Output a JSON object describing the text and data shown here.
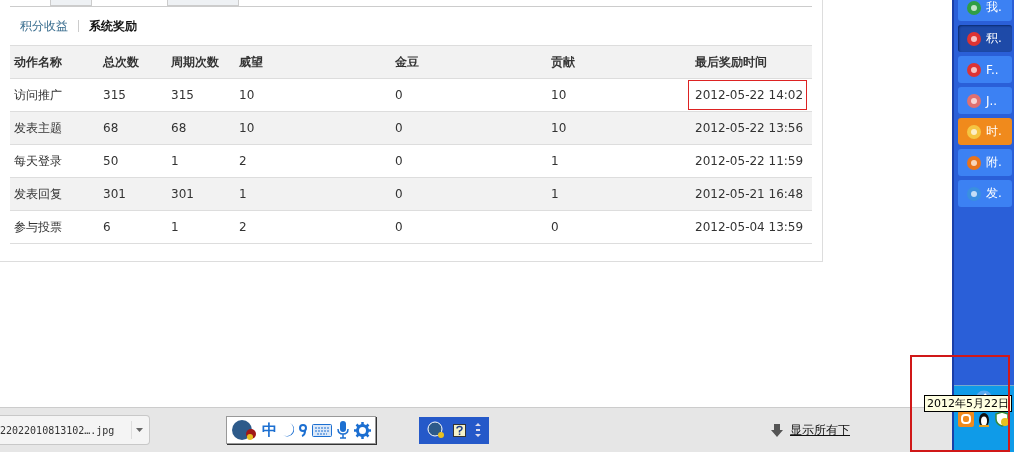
{
  "subtabs": [
    {
      "label": "积分收益",
      "selected": false
    },
    {
      "label": "系统奖励",
      "selected": true
    }
  ],
  "table": {
    "columns": [
      "动作名称",
      "总次数",
      "周期次数",
      "威望",
      "金豆",
      "贡献",
      "最后奖励时间"
    ],
    "rows": [
      {
        "cells": [
          "访问推广",
          "315",
          "315",
          "10",
          "0",
          "10",
          "2012-05-22 14:02"
        ],
        "highlighted": true
      },
      {
        "cells": [
          "发表主题",
          "68",
          "68",
          "10",
          "0",
          "10",
          "2012-05-22 13:56"
        ],
        "highlighted": false
      },
      {
        "cells": [
          "每天登录",
          "50",
          "1",
          "2",
          "0",
          "1",
          "2012-05-22 11:59"
        ],
        "highlighted": false
      },
      {
        "cells": [
          "发表回复",
          "301",
          "301",
          "1",
          "0",
          "1",
          "2012-05-21 16:48"
        ],
        "highlighted": false
      },
      {
        "cells": [
          "参与投票",
          "6",
          "1",
          "2",
          "0",
          "0",
          "2012-05-04 13:59"
        ],
        "highlighted": false
      }
    ]
  },
  "taskbar": {
    "buttons": [
      {
        "label": "我.",
        "selected": false,
        "flashing": false
      },
      {
        "label": "积.",
        "selected": true,
        "flashing": false
      },
      {
        "label": "F..",
        "selected": false,
        "flashing": false
      },
      {
        "label": "J..",
        "selected": false,
        "flashing": false
      },
      {
        "label": "时.",
        "selected": false,
        "flashing": true
      },
      {
        "label": "附.",
        "selected": false,
        "flashing": false
      },
      {
        "label": "发.",
        "selected": false,
        "flashing": false
      }
    ],
    "tray_tooltip": "2012年5月22日"
  },
  "download_bar": {
    "item": "22022010813102….jpg",
    "ime_char": "中",
    "show_all": "显示所有下"
  }
}
